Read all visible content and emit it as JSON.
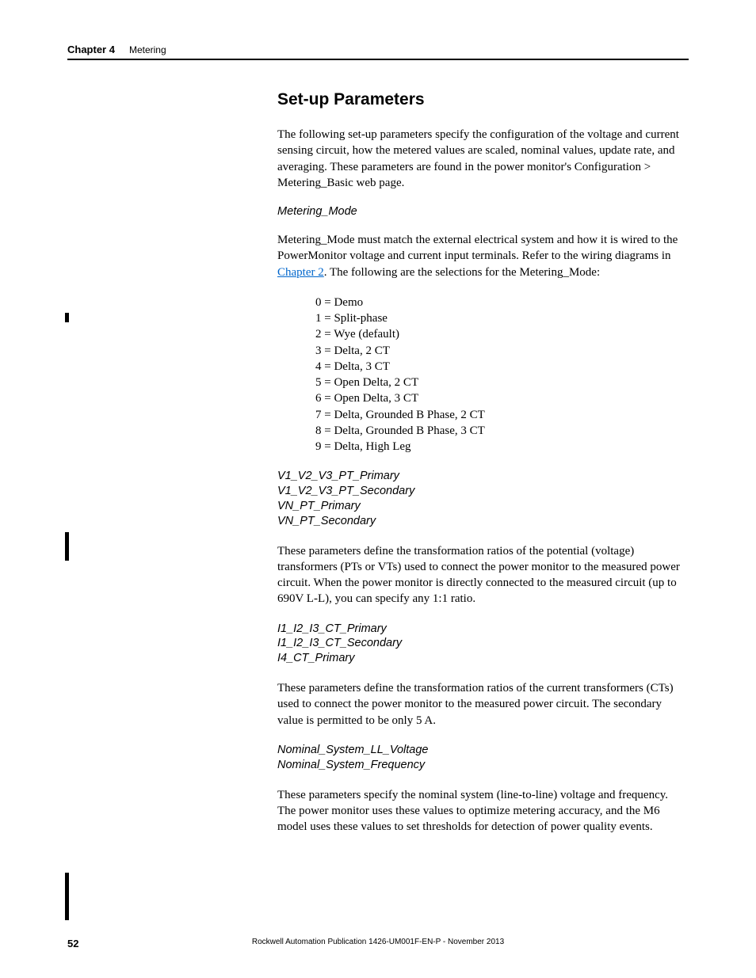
{
  "header": {
    "chapter_num": "Chapter 4",
    "chapter_title": "Metering"
  },
  "section_heading": "Set-up Parameters",
  "intro_para": "The following set-up parameters specify the configuration of the voltage and current sensing circuit, how the metered values are scaled, nominal values, update rate, and averaging. These parameters are found in the power monitor's Configuration > Metering_Basic web page.",
  "metering_mode": {
    "heading": "Metering_Mode",
    "para_before_link": "Metering_Mode must match the external electrical system and how it is wired to the PowerMonitor voltage and current input terminals. Refer to the wiring diagrams in ",
    "link_text": "Chapter 2",
    "para_after_link": ". The following are the selections for the Metering_Mode:",
    "modes": [
      "0 = Demo",
      "1 = Split-phase",
      "2 = Wye (default)",
      "3 = Delta, 2 CT",
      "4 = Delta, 3 CT",
      "5 = Open Delta, 2 CT",
      "6 = Open Delta, 3 CT",
      "7 = Delta, Grounded B Phase, 2 CT",
      "8 = Delta, Grounded B Phase, 3 CT",
      "9 = Delta, High Leg"
    ]
  },
  "pt_section": {
    "headings": [
      "V1_V2_V3_PT_Primary",
      "V1_V2_V3_PT_Secondary",
      "VN_PT_Primary",
      "VN_PT_Secondary"
    ],
    "para": "These parameters define the transformation ratios of the potential (voltage) transformers (PTs or VTs) used to connect the power monitor to the measured power circuit. When the power monitor is directly connected to the measured circuit (up to 690V L-L), you can specify any 1:1 ratio."
  },
  "ct_section": {
    "headings": [
      "I1_I2_I3_CT_Primary",
      "I1_I2_I3_CT_Secondary",
      "I4_CT_Primary"
    ],
    "para": "These parameters define the transformation ratios of the current transformers (CTs) used to connect the power monitor to the measured power circuit. The secondary value is permitted to be only 5 A."
  },
  "nominal_section": {
    "headings": [
      "Nominal_System_LL_Voltage",
      "Nominal_System_Frequency"
    ],
    "para": "These parameters specify the nominal system (line-to-line) voltage and frequency. The power monitor uses these values to optimize metering accuracy, and the M6 model uses these values to set thresholds for detection of power quality events."
  },
  "footer": {
    "page_num": "52",
    "text": "Rockwell Automation Publication 1426-UM001F-EN-P - November 2013"
  }
}
